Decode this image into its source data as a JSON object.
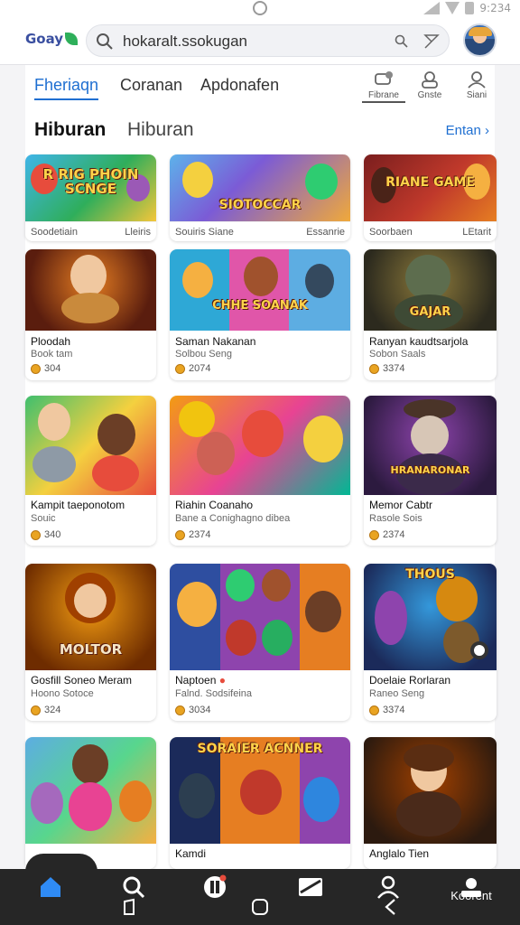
{
  "status_bar": {
    "time": "9:234"
  },
  "header": {
    "logo": "Goay",
    "search": {
      "value": "hokaralt.ssokugan",
      "placeholder": ""
    }
  },
  "tabs": [
    {
      "label": "Fheriaqn",
      "active": true
    },
    {
      "label": "Coranan",
      "active": false
    },
    {
      "label": "Apdonafen",
      "active": false
    }
  ],
  "tab_icons": [
    {
      "label": "Fibrane",
      "icon": "chat-bubble-icon",
      "active": true
    },
    {
      "label": "Gnste",
      "icon": "profile-icon",
      "active": false
    },
    {
      "label": "Siani",
      "icon": "user-icon",
      "active": false
    }
  ],
  "section": {
    "title": "Hiburan",
    "subtitle": "Hiburan",
    "see_all": "Entan"
  },
  "row1": [
    {
      "title": "R RIG PHOIN SCNGE",
      "left": "Soodetiain",
      "right": "Lleiris"
    },
    {
      "title": "SIOTOCCAR",
      "left": "Souiris Siane",
      "right": "Essanrie"
    },
    {
      "title": "RIANE GAME",
      "left": "Soorbaen",
      "right": "LEtarit"
    }
  ],
  "cards": [
    {
      "title": "",
      "name": "Ploodah",
      "sub": "Book tam",
      "rating": "304"
    },
    {
      "title": "CHHE SOANAK",
      "name": "Saman Nakanan",
      "sub": "Solbou Seng",
      "rating": "2074"
    },
    {
      "title": "GAJAR",
      "name": "Ranyan kaudtsarjola",
      "sub": "Sobon Saals",
      "rating": "3374"
    },
    {
      "title": "",
      "name": "Kampit taeponotom",
      "sub": "Souic",
      "rating": "340"
    },
    {
      "title": "",
      "name": "Riahin Coanaho",
      "sub": "Bane a Conighagno dibea",
      "rating": "2374"
    },
    {
      "title": "HRANARONAR",
      "name": "Memor Cabtr",
      "sub": "Rasole Sois",
      "rating": "2374"
    },
    {
      "title": "MOLTOR",
      "name": "Gosfill Soneo Meram",
      "sub": "Hoono Sotoce",
      "rating": "324"
    },
    {
      "title": "",
      "name": "Naptoen",
      "sub": "Falnd. Sodsifeina",
      "rating": "3034"
    },
    {
      "title": "THOUS",
      "name": "Doelaie Rorlaran",
      "sub": "Raneo Seng",
      "rating": "3374"
    },
    {
      "title": "",
      "name": "",
      "sub": "",
      "rating": ""
    },
    {
      "title": "SORAIER ACNNER",
      "name": "Kamdi",
      "sub": "",
      "rating": ""
    },
    {
      "title": "",
      "name": "Anglalo Tien",
      "sub": "",
      "rating": ""
    }
  ],
  "bottom_nav": [
    {
      "icon": "home-icon"
    },
    {
      "icon": "search-icon"
    },
    {
      "icon": "game-icon"
    },
    {
      "icon": "mail-icon"
    },
    {
      "icon": "person-icon"
    },
    {
      "icon": "account-icon",
      "label": "Koorent"
    }
  ]
}
